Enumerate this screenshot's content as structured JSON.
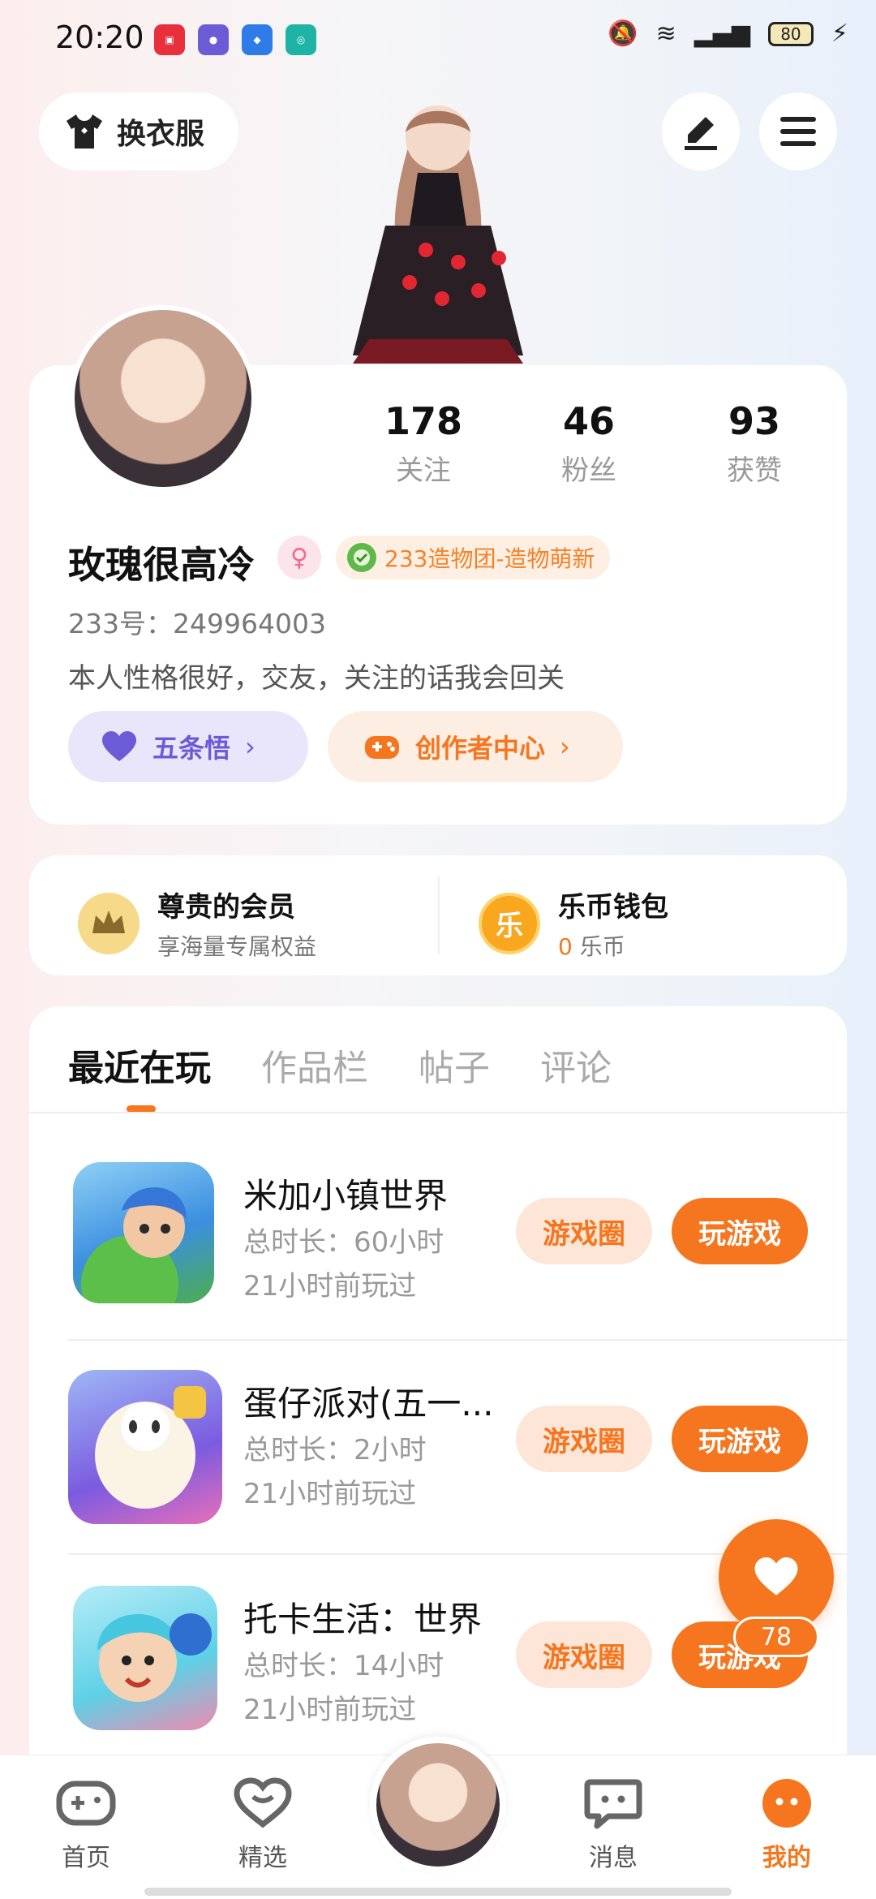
{
  "status_bar": {
    "time": "20:20",
    "battery": "80"
  },
  "top": {
    "dress_label": "换衣服"
  },
  "profile": {
    "stats": [
      {
        "value": "178",
        "label": "关注"
      },
      {
        "value": "46",
        "label": "粉丝"
      },
      {
        "value": "93",
        "label": "获赞"
      }
    ],
    "name": "玫瑰很高冷",
    "gender_symbol": "♀",
    "tag": "233造物团-造物萌新",
    "uid": "233号：249964003",
    "bio": "本人性格很好，交友，关注的话我会回关",
    "pill1": "五条悟",
    "pill2": "创作者中心"
  },
  "member": {
    "vip_title": "尊贵的会员",
    "vip_sub": "享海量专属权益",
    "wallet_icon_text": "乐",
    "wallet_title": "乐币钱包",
    "wallet_amount": "0",
    "wallet_unit": "乐币"
  },
  "tabs": [
    "最近在玩",
    "作品栏",
    "帖子",
    "评论"
  ],
  "games": [
    {
      "title": "米加小镇世界",
      "duration": "总时长：60小时",
      "last": "21小时前玩过",
      "circle": "游戏圈",
      "play": "玩游戏"
    },
    {
      "title": "蛋仔派对(五一...",
      "duration": "总时长：2小时",
      "last": "21小时前玩过",
      "circle": "游戏圈",
      "play": "玩游戏"
    },
    {
      "title": "托卡生活：世界",
      "duration": "总时长：14小时",
      "last": "21小时前玩过",
      "circle": "游戏圈",
      "play": "玩游戏"
    }
  ],
  "fab": {
    "count": "78"
  },
  "nav": [
    {
      "label": "首页"
    },
    {
      "label": "精选"
    },
    {
      "label": "消息"
    },
    {
      "label": "我的"
    }
  ],
  "colors": {
    "accent": "#f5761e",
    "purple": "#6b5bd6"
  }
}
